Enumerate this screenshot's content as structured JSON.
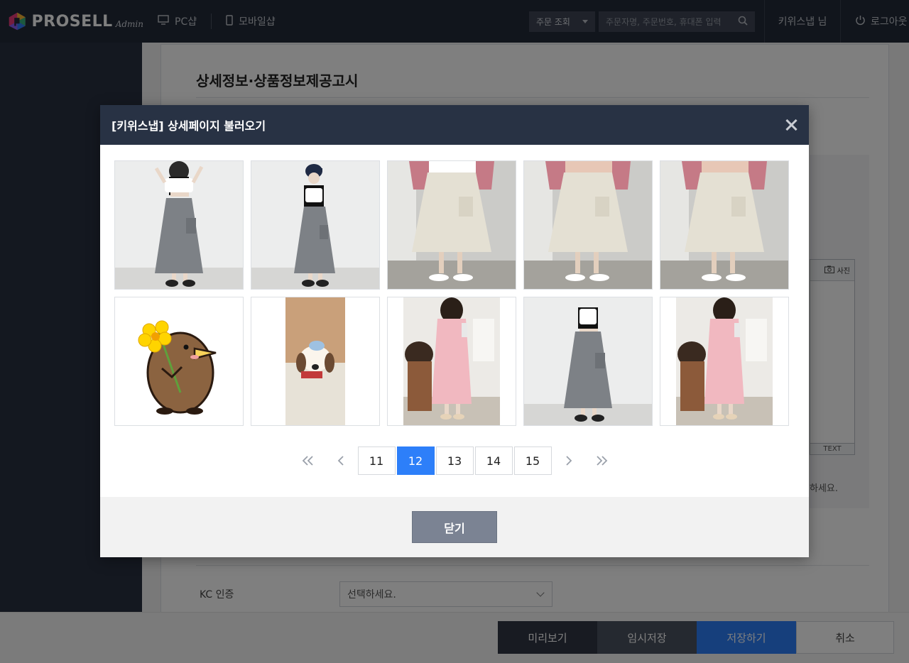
{
  "topbar": {
    "logo_text": "PROSELL",
    "logo_sub": "Admin",
    "nav": [
      {
        "label": "PC샵",
        "icon": "monitor-icon"
      },
      {
        "label": "모바일샵",
        "icon": "mobile-icon"
      }
    ],
    "order_select": "주문 조회",
    "search_placeholder": "주문자명, 주문번호, 휴대폰 입력",
    "user": "키위스냅 님",
    "logout": "로그아웃"
  },
  "content": {
    "section_title": "상세정보·상품정보제공고시",
    "editor_photo": "사진",
    "editor_tab": "TEXT",
    "hint": "하세요.",
    "kc_label": "KC 인증",
    "kc_select": "선택하세요."
  },
  "bottom_bar": {
    "preview": "미리보기",
    "temp_save": "임시저장",
    "save": "저장하기",
    "cancel": "취소"
  },
  "modal": {
    "title": "[키위스냅] 상세페이지 불러오기",
    "thumbnails": [
      {
        "subject": "gray-cargo-skirt-model"
      },
      {
        "subject": "gray-cargo-skirt-model-cap"
      },
      {
        "subject": "beige-cargo-skirt-legs"
      },
      {
        "subject": "beige-cargo-skirt-legs"
      },
      {
        "subject": "beige-cargo-skirt-legs"
      },
      {
        "subject": "kiwi-bird-flower-illustration"
      },
      {
        "subject": "dog-plush-in-bag"
      },
      {
        "subject": "pink-dress-model"
      },
      {
        "subject": "gray-cargo-skirt-model"
      },
      {
        "subject": "pink-dress-model"
      }
    ],
    "pagination": {
      "pages": [
        "11",
        "12",
        "13",
        "14",
        "15"
      ],
      "active": "12"
    },
    "close_label": "닫기"
  },
  "colors": {
    "accent": "#2d7ff9",
    "header_bg": "#283244",
    "topbar_bg": "#232a39"
  }
}
